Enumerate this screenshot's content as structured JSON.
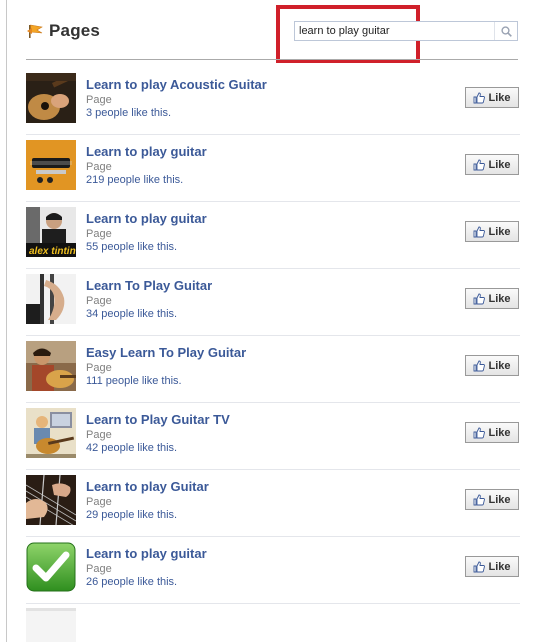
{
  "header": {
    "title": "Pages",
    "icon": "flag-icon"
  },
  "search": {
    "value": "learn to play guitar",
    "button_icon": "magnifier-icon"
  },
  "highlight_color": "#d0202a",
  "link_color": "#3b5998",
  "results": [
    {
      "name": "Learn to play Acoustic Guitar",
      "type": "Page",
      "likes": "3 people like this.",
      "button": "Like",
      "thumb": "acoustic-guitar-photo"
    },
    {
      "name": "Learn to play guitar",
      "type": "Page",
      "likes": "219 people like this.",
      "button": "Like",
      "thumb": "electric-guitar-photo"
    },
    {
      "name": "Learn to play guitar",
      "type": "Page",
      "likes": "55 people like this.",
      "button": "Like",
      "thumb": "alex-tintin-photo",
      "thumb_caption": "alex tintin"
    },
    {
      "name": "Learn To Play Guitar",
      "type": "Page",
      "likes": "34 people like this.",
      "button": "Like",
      "thumb": "guitar-chord-hand-photo"
    },
    {
      "name": "Easy Learn To Play Guitar",
      "type": "Page",
      "likes": "111 people like this.",
      "button": "Like",
      "thumb": "guitarist-photo"
    },
    {
      "name": "Learn to Play Guitar TV",
      "type": "Page",
      "likes": "42 people like this.",
      "button": "Like",
      "thumb": "guitar-tv-illustration"
    },
    {
      "name": "Learn to play Guitar",
      "type": "Page",
      "likes": "29 people like this.",
      "button": "Like",
      "thumb": "fretboard-closeup-photo"
    },
    {
      "name": "Learn to play guitar",
      "type": "Page",
      "likes": "26 people like this.",
      "button": "Like",
      "thumb": "green-checkmark-icon"
    }
  ]
}
